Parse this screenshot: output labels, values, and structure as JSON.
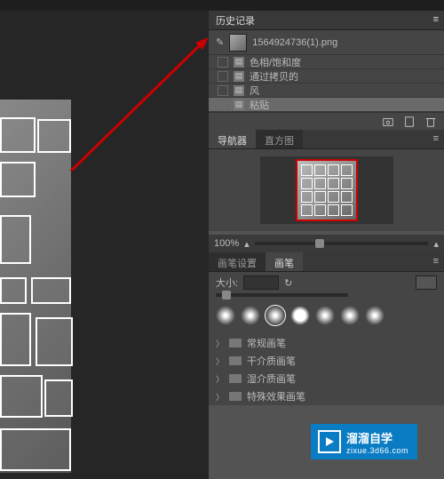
{
  "history": {
    "title": "历史记录",
    "fileName": "1564924736(1).png",
    "items": [
      {
        "label": "色相/饱和度"
      },
      {
        "label": "通过拷贝的"
      },
      {
        "label": "风"
      },
      {
        "label": "粘贴"
      }
    ]
  },
  "navigator": {
    "tabs": [
      "导航器",
      "直方图"
    ],
    "zoom": "100%"
  },
  "brushPanel": {
    "tabs": [
      "画笔设置",
      "画笔"
    ],
    "sizeLabel": "大小:"
  },
  "brushFolders": [
    "常规画笔",
    "干介质画笔",
    "湿介质画笔",
    "特殊效果画笔"
  ],
  "brand": {
    "name": "溜溜自学",
    "url": "zixue.3d66.com"
  }
}
